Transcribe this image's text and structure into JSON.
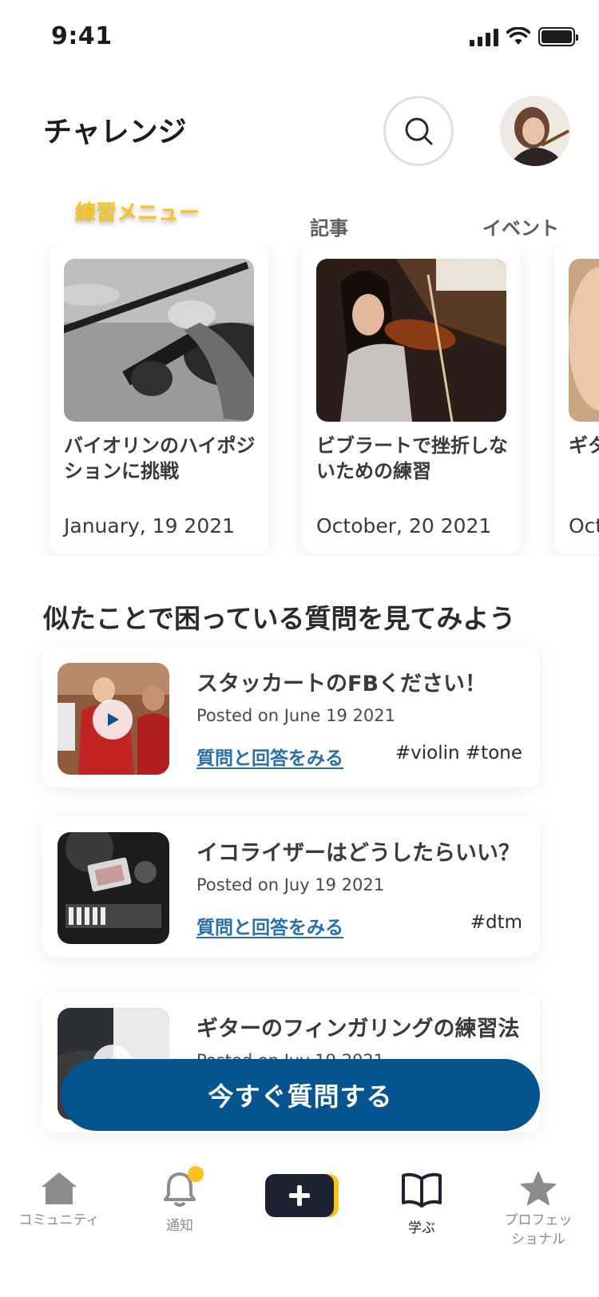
{
  "status_bar": {
    "time": "9:41"
  },
  "header": {
    "title": "チャレンジ"
  },
  "tabs": [
    {
      "label": "練習メニュー",
      "active": true
    },
    {
      "label": "記事",
      "active": false
    },
    {
      "label": "イベント",
      "active": false
    }
  ],
  "cards": [
    {
      "title": "バイオリンのハイポジションに挑戦",
      "date": "January, 19 2021"
    },
    {
      "title": "ビブラートで挫折しないための練習",
      "date": "October, 20 2021"
    },
    {
      "title": "ギタ",
      "date": "Oct"
    }
  ],
  "section": {
    "title": "似たことで困っている質問を見てみよう"
  },
  "questions": [
    {
      "title": "スタッカートのFBください！",
      "posted": "Posted on June 19 2021",
      "link": "質問と回答をみる",
      "tags": "#violin #tone",
      "has_video": true
    },
    {
      "title": "イコライザーはどうしたらいい？",
      "posted": "Posted on Juy 19 2021",
      "link": "質問と回答をみる",
      "tags": "#dtm",
      "has_video": false
    },
    {
      "title": "ギターのフィンガリングの練習法",
      "posted": "Posted on Juy 19 2021",
      "link": "",
      "tags": "",
      "has_video": true
    }
  ],
  "cta": {
    "label": "今すぐ質問する"
  },
  "bottom_nav": [
    {
      "label": "コミュニティ",
      "icon": "home-icon"
    },
    {
      "label": "通知",
      "icon": "bell-icon"
    },
    {
      "label": "",
      "icon": "plus-icon"
    },
    {
      "label": "学ぶ",
      "icon": "book-icon",
      "active": true
    },
    {
      "label": "プロフェッショナル",
      "icon": "star-icon"
    }
  ],
  "colors": {
    "primary": "#04548f",
    "accent": "#f9c21c",
    "link": "#2a6fa8",
    "dark": "#1d2331"
  }
}
